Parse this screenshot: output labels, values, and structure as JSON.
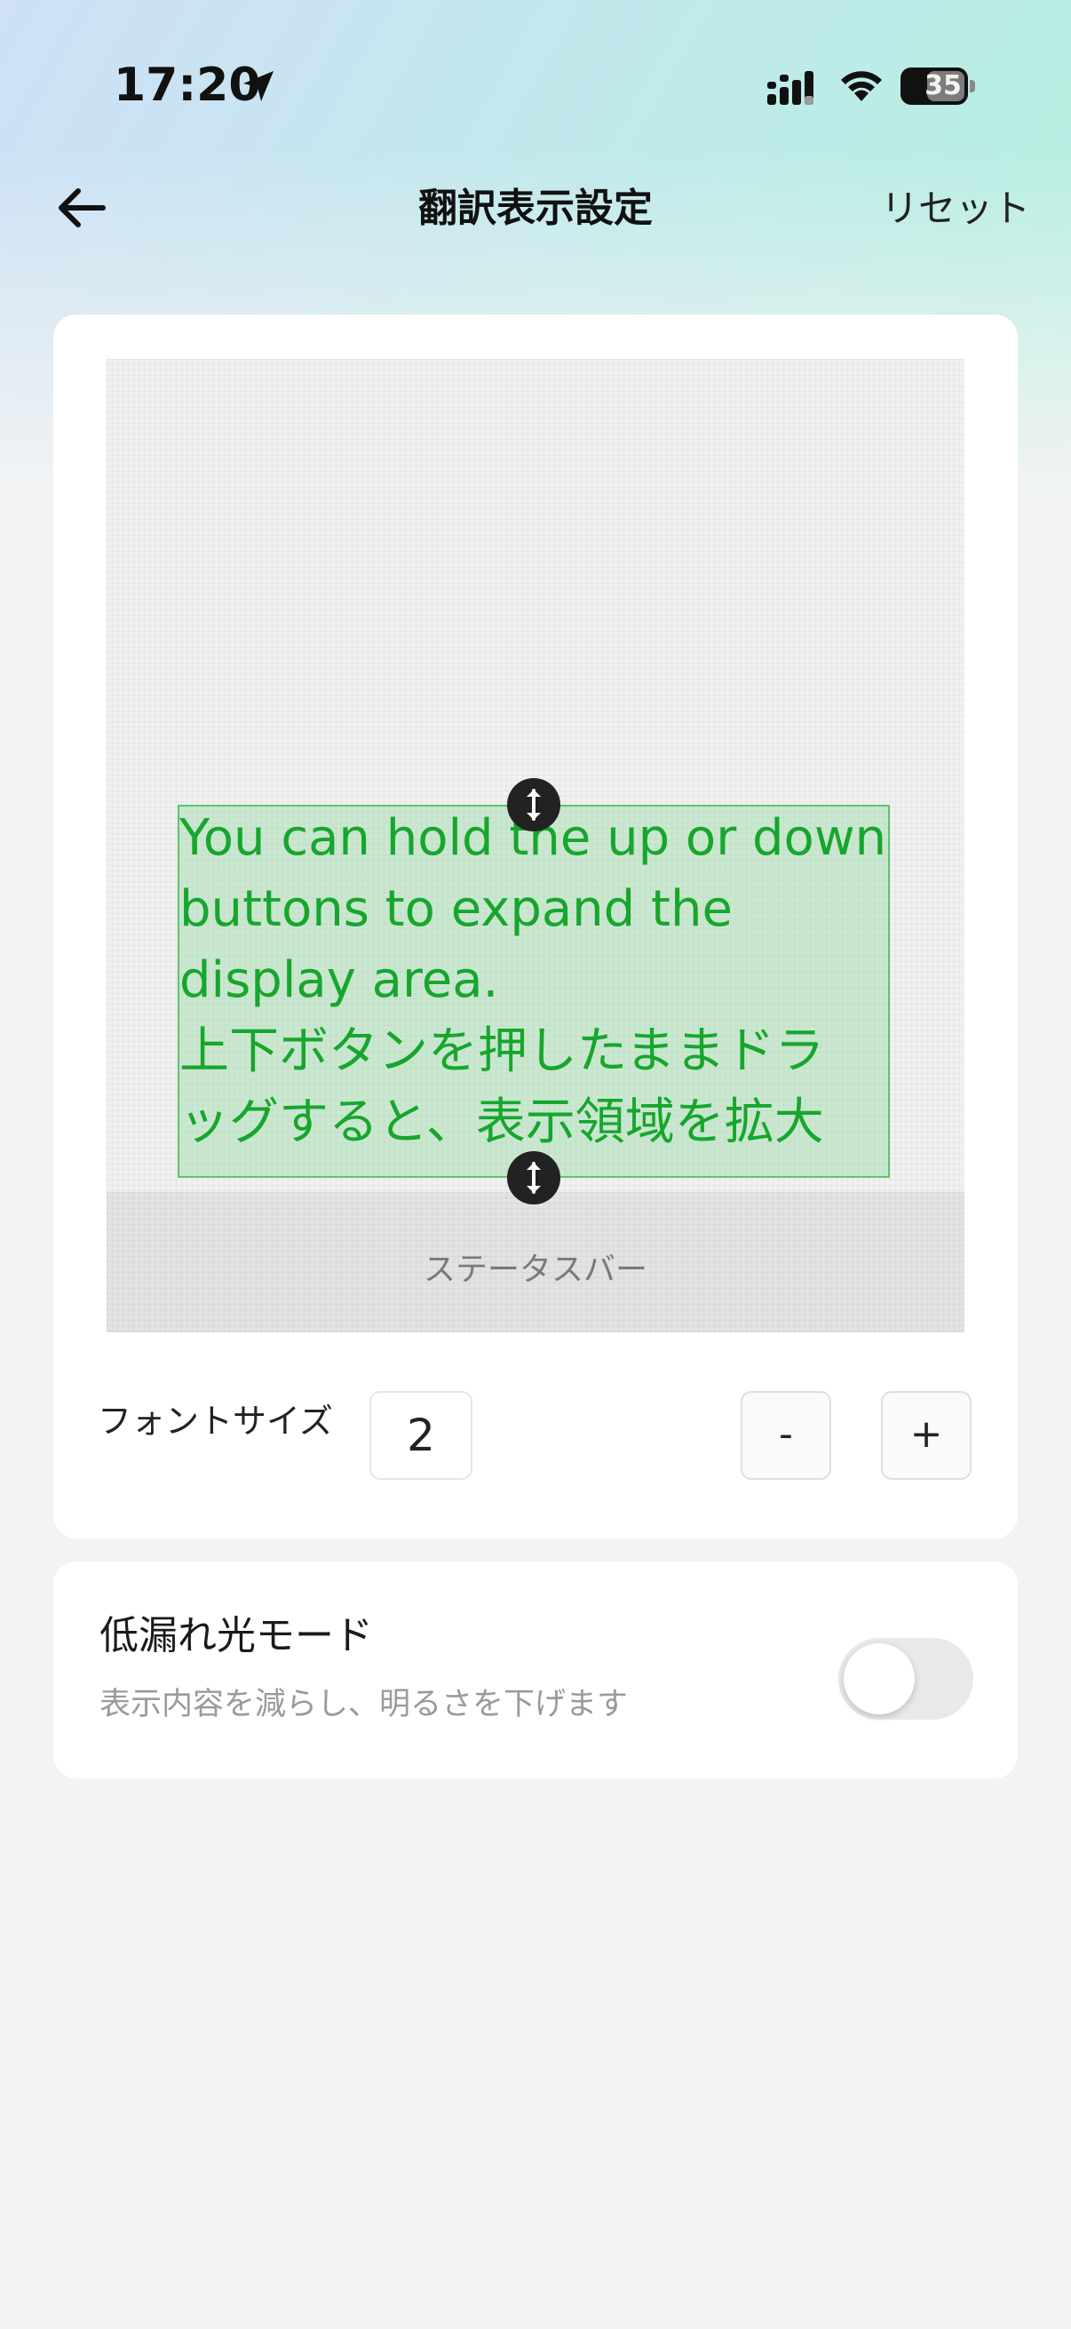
{
  "status_bar": {
    "time": "17:20",
    "battery_level": "35",
    "icons": {
      "location": "location-arrow-icon",
      "signal": "cellular-signal-icon",
      "wifi": "wifi-icon",
      "battery": "battery-icon"
    }
  },
  "nav": {
    "back_icon": "arrow-left-icon",
    "title": "翻訳表示設定",
    "reset_label": "リセット"
  },
  "preview": {
    "display_text": "You can hold the up or down\nbuttons to expand the\ndisplay area.\n上下ボタンを押したままドラ\nッグすると、表示領域を拡大",
    "status_bar_label": "ステータスバー",
    "text_color": "#17a62d",
    "handle_icon": "vertical-resize-arrows-icon"
  },
  "font_size": {
    "label": "フォントサイズ",
    "value": "2",
    "decrease_label": "-",
    "increase_label": "+"
  },
  "low_light_mode": {
    "title": "低漏れ光モード",
    "description": "表示内容を減らし、明るさを下げます",
    "enabled": false
  }
}
